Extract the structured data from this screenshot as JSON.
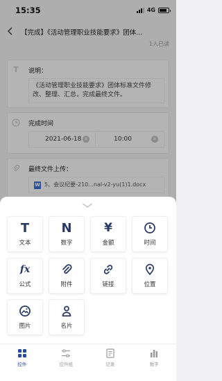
{
  "status_bar": {
    "time": "15:35",
    "network": "4G"
  },
  "header": {
    "title": "【完成】《活动管理职业技能要求》团体...",
    "readers": "1人已读"
  },
  "fields": {
    "description": {
      "icon": "T",
      "label": "说明：",
      "text": "《活动管理职业技能要求》团体标准文件修改、整理、汇总，完成最终文件。"
    },
    "completion_time": {
      "label": "完成时间",
      "date": "2021-06-18",
      "time": "10:00"
    },
    "final_file": {
      "label": "最终文件上传：",
      "file_name": "5、会议纪要-210...nal-v2-yu(1)1.docx"
    }
  },
  "sheet": {
    "tiles": [
      {
        "name": "text",
        "label": "文本",
        "icon": "T"
      },
      {
        "name": "number",
        "label": "数字",
        "icon": "N"
      },
      {
        "name": "amount",
        "label": "金额",
        "icon": "¥"
      },
      {
        "name": "time",
        "label": "时间",
        "icon": "clock-icon"
      },
      {
        "name": "formula",
        "label": "公式",
        "icon": "fx"
      },
      {
        "name": "attachment",
        "label": "附件",
        "icon": "paperclip-icon"
      },
      {
        "name": "link",
        "label": "链接",
        "icon": "link-icon"
      },
      {
        "name": "location",
        "label": "位置",
        "icon": "map-pin-icon"
      },
      {
        "name": "image",
        "label": "图片",
        "icon": "image-icon"
      },
      {
        "name": "card",
        "label": "名片",
        "icon": "person-icon"
      }
    ]
  },
  "tabbar": {
    "items": [
      {
        "label": "控件",
        "active": true
      },
      {
        "label": "控件组",
        "active": false
      },
      {
        "label": "记录",
        "active": false
      },
      {
        "label": "数字",
        "active": false
      }
    ]
  },
  "colors": {
    "accent": "#2a4d9b",
    "icon_dark": "#2a3b63",
    "background": "#f1f1f3"
  }
}
